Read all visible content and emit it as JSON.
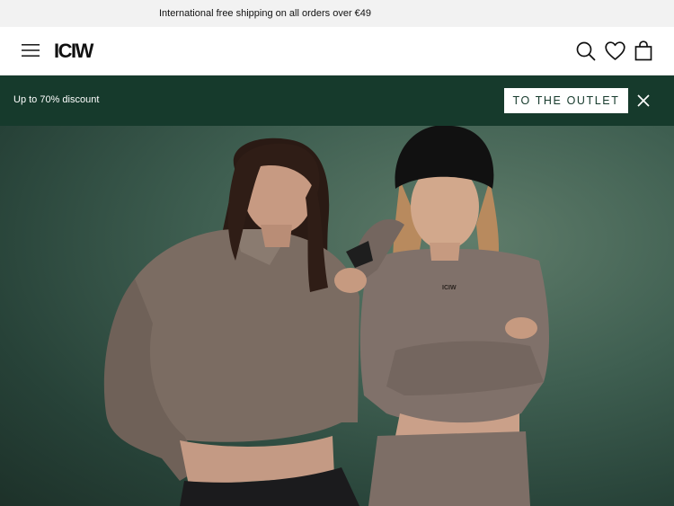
{
  "announcement": {
    "text": "International free shipping on all orders over €49"
  },
  "header": {
    "logo_text": "ICIW",
    "icons": [
      "menu-icon",
      "search-icon",
      "heart-icon",
      "bag-icon"
    ]
  },
  "promo": {
    "text": "Up to 70% discount",
    "button_label": "TO THE OUTLET",
    "close_icon": "close-icon",
    "background": "#163a2c"
  },
  "hero": {
    "image": "two-models-in-taupe-activewear",
    "shirt_logo_text": "ICIW"
  }
}
